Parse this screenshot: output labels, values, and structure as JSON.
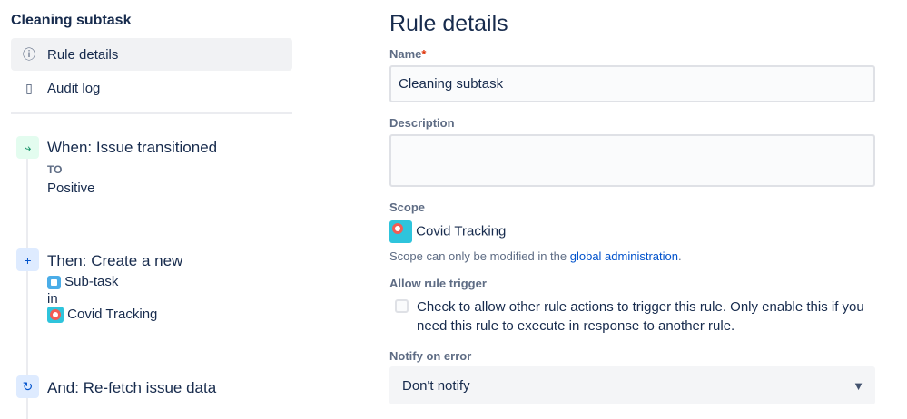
{
  "sidebar": {
    "title": "Cleaning subtask",
    "nav": [
      {
        "label": "Rule details"
      },
      {
        "label": "Audit log"
      }
    ],
    "steps": {
      "trigger": {
        "title": "When: Issue transitioned",
        "to_label": "TO",
        "to_value": "Positive"
      },
      "action": {
        "title": "Then: Create a new",
        "issue_type": "Sub-task",
        "in_label": "in",
        "project": "Covid Tracking"
      },
      "refetch": {
        "title": "And: Re-fetch issue data"
      }
    }
  },
  "main": {
    "title": "Rule details",
    "name_label": "Name",
    "required_mark": "*",
    "name_value": "Cleaning subtask",
    "description_label": "Description",
    "description_value": "",
    "scope_label": "Scope",
    "scope_project": "Covid Tracking",
    "scope_note": "Scope can only be modified in the ",
    "scope_link": "global administration",
    "scope_period": ".",
    "allow_label": "Allow rule trigger",
    "allow_text": "Check to allow other rule actions to trigger this rule. Only enable this if you need this rule to execute in response to another rule.",
    "allow_checked": false,
    "notify_label": "Notify on error",
    "notify_value": "Don't notify"
  }
}
